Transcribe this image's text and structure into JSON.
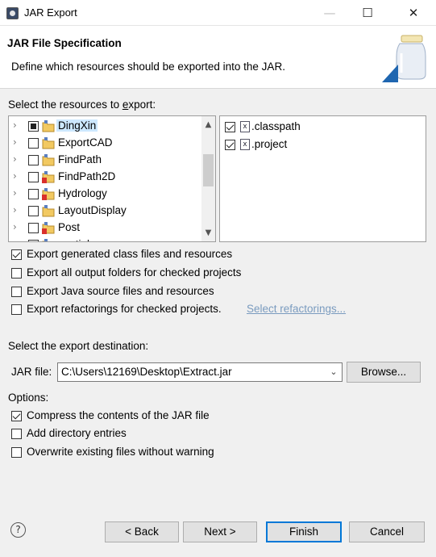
{
  "window": {
    "title": "JAR Export",
    "minimize_icon": "minimize-icon",
    "maximize_icon": "maximize-icon",
    "close_icon": "close-icon"
  },
  "header": {
    "title": "JAR File Specification",
    "description": "Define which resources should be exported into the JAR.",
    "icon": "jar-icon"
  },
  "resources": {
    "label": "Select the resources to export:",
    "projects": [
      {
        "name": "DingXin",
        "state": "partial",
        "selected": true,
        "error": false
      },
      {
        "name": "ExportCAD",
        "state": "unchecked",
        "selected": false,
        "error": false
      },
      {
        "name": "FindPath",
        "state": "unchecked",
        "selected": false,
        "error": false
      },
      {
        "name": "FindPath2D",
        "state": "unchecked",
        "selected": false,
        "error": true
      },
      {
        "name": "Hydrology",
        "state": "unchecked",
        "selected": false,
        "error": true
      },
      {
        "name": "LayoutDisplay",
        "state": "unchecked",
        "selected": false,
        "error": false
      },
      {
        "name": "Post",
        "state": "unchecked",
        "selected": false,
        "error": true
      },
      {
        "name": "spatial",
        "state": "unchecked",
        "selected": false,
        "error": false
      }
    ],
    "files": [
      {
        "name": ".classpath",
        "checked": true
      },
      {
        "name": ".project",
        "checked": true
      }
    ]
  },
  "options_export": [
    {
      "text": "Export generated class files and resources",
      "checked": true
    },
    {
      "text": "Export all output folders for checked projects",
      "checked": false
    },
    {
      "text": "Export Java source files and resources",
      "checked": false
    },
    {
      "text": "Export refactorings for checked projects.",
      "checked": false,
      "link": "Select refactorings..."
    }
  ],
  "destination": {
    "label": "Select the export destination:",
    "jar_label": "JAR file:",
    "jar_value": "C:\\Users\\12169\\Desktop\\Extract.jar",
    "browse": "Browse..."
  },
  "options": {
    "label": "Options:",
    "items": [
      {
        "text": "Compress the contents of the JAR file",
        "checked": true
      },
      {
        "text": "Add directory entries",
        "checked": false
      },
      {
        "text": "Overwrite existing files without warning",
        "checked": false
      }
    ]
  },
  "buttons": {
    "back": "< Back",
    "next": "Next >",
    "finish": "Finish",
    "cancel": "Cancel",
    "help_icon": "help-icon"
  }
}
